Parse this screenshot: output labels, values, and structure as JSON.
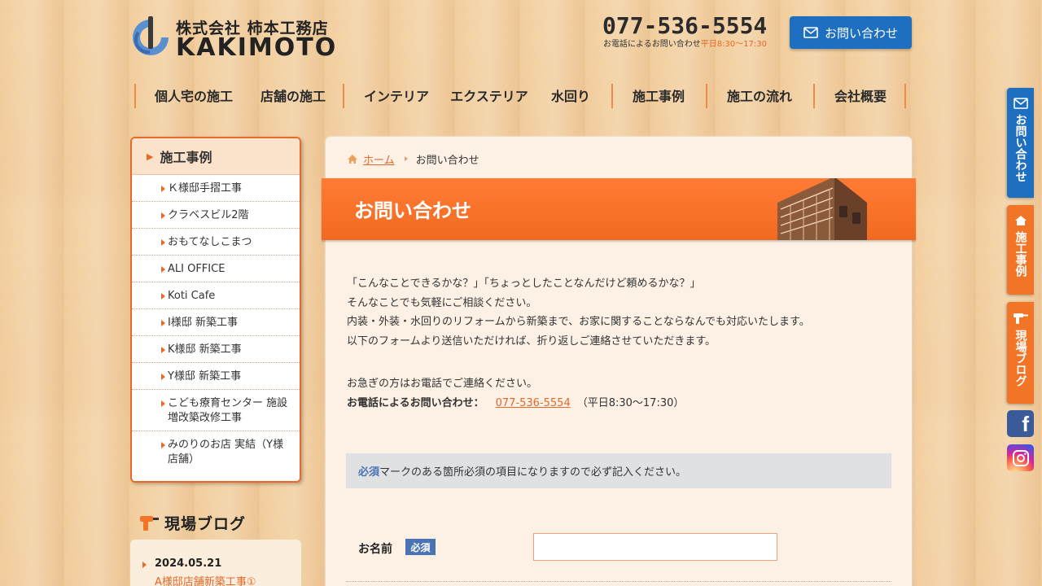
{
  "header": {
    "company_name": "株式会社 柿本工務店",
    "logo_text": "KAKIMOTO",
    "tel": "077-536-5554",
    "tel_note": "お電話によるお問い合わせ",
    "tel_hours": "平日8:30～17:30",
    "contact_button": "お問い合わせ",
    "accent_blue": "#1f6fc0",
    "accent_orange": "#f26a22"
  },
  "nav": {
    "items": [
      "個人宅の施工",
      "店舗の施工",
      "インテリア",
      "エクステリア",
      "水回り",
      "施工事例",
      "施工の流れ",
      "会社概要"
    ]
  },
  "sidebar": {
    "heading": "施工事例",
    "items": [
      "Ｋ様邸手摺工事",
      "クラベスビル2階",
      "おもてなしこまつ",
      "ALI OFFICE",
      "Koti Cafe",
      "I様邸 新築工事",
      "K様邸 新築工事",
      "Y様邸 新築工事",
      "こども療育センター 施設増改築改修工事",
      "みのりのお店 実結（Y様店舗）"
    ],
    "blog_title": "現場ブログ",
    "blog_date": "2024.05.21",
    "blog_link": "A様邸店舗新築工事①"
  },
  "breadcrumb": {
    "home": "ホーム",
    "current": "お問い合わせ"
  },
  "page": {
    "title": "お問い合わせ",
    "intro": [
      "「こんなことできるかな？」「ちょっとしたことなんだけど頼めるかな？」",
      "そんなことでも気軽にご相談ください。",
      "内装・外装・水回りのリフォームから新築まで、お家に関することならなんでも対応いたします。",
      "以下のフォームより送信いただければ、折り返しご連絡させていただきます。"
    ],
    "urgent": "お急ぎの方はお電話でご連絡ください。",
    "tel_label": "お電話によるお問い合わせ：",
    "tel": "077-536-5554",
    "tel_hours": "（平日8:30～17:30）",
    "notice_required": "必須",
    "notice_rest": "マークのある箇所必須の項目になりますので必ず記入ください。"
  },
  "form": {
    "name_label": "お名前",
    "required_badge": "必須",
    "name_value": ""
  },
  "side_tabs": {
    "contact": "お問い合わせ",
    "works": "施工事例",
    "blog": "現場ブログ",
    "facebook_icon": "facebook-icon",
    "instagram_icon": "instagram-icon"
  }
}
